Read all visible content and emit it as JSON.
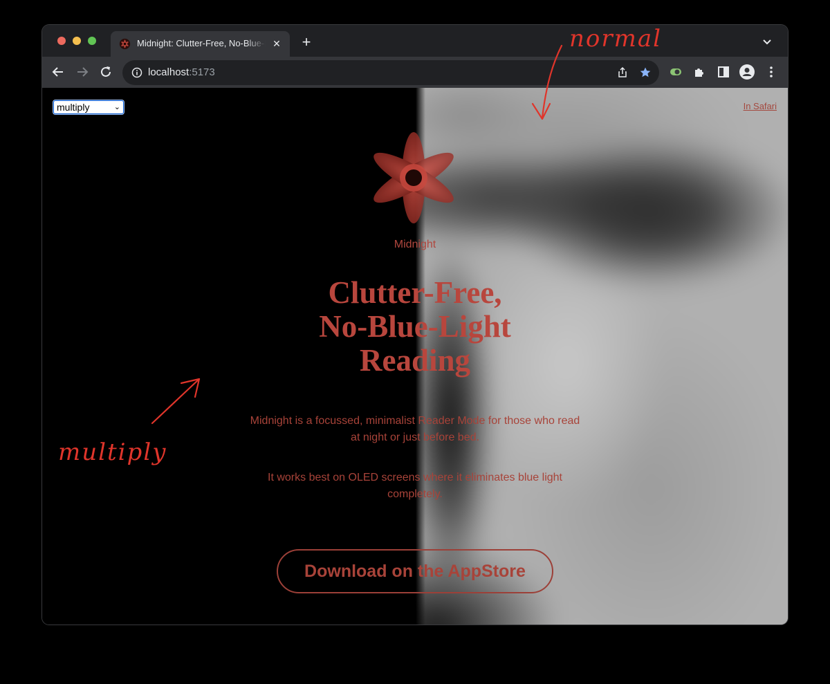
{
  "browser": {
    "tab_title": "Midnight: Clutter-Free, No-Blue-Light Reading",
    "tab_close": "✕",
    "new_tab": "+",
    "url_host": "localhost",
    "url_port": ":5173"
  },
  "page": {
    "blend_mode_select": "multiply",
    "top_right_link": "In Safari",
    "app_name": "Midnight",
    "headline_lines": [
      "Clutter-Free,",
      "No-Blue-Light",
      "Reading"
    ],
    "paragraph_1": "Midnight is a focussed, minimalist Reader Mode for those who read at night or just before bed.",
    "paragraph_2": "It works best on OLED screens where it eliminates blue light completely.",
    "cta_label": "Download on the AppStore"
  },
  "annotations": {
    "top_label": "normal",
    "bottom_label": "multiply"
  },
  "colors": {
    "accent_red": "#b8463d",
    "annotation_red": "#e0352b",
    "chrome_dark": "#202124",
    "chrome_toolbar": "#35363a",
    "bookmark_star": "#8ab4f8"
  },
  "icons": [
    "back-arrow-icon",
    "forward-arrow-icon",
    "reload-icon",
    "info-icon",
    "share-icon",
    "bookmark-star-icon",
    "extension-badge-icon",
    "puzzle-icon",
    "sidepanel-icon",
    "profile-icon",
    "kebab-menu-icon",
    "tab-search-chevron-icon",
    "midnight-flower-logo"
  ]
}
